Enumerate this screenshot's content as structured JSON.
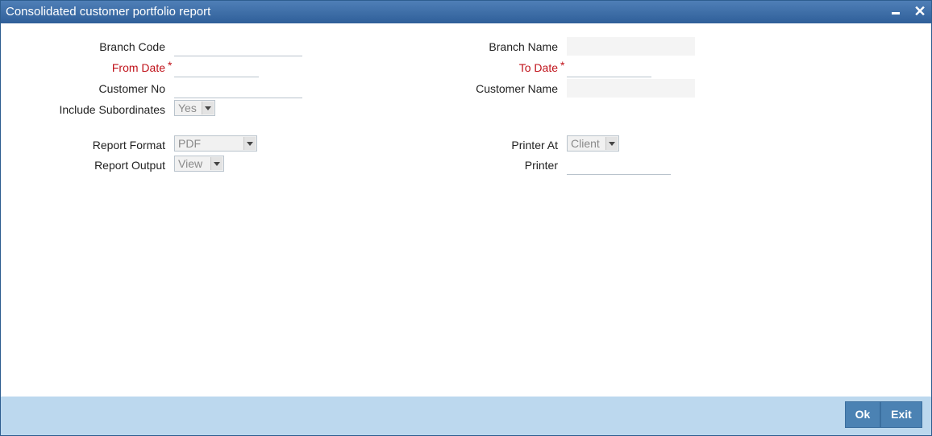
{
  "window": {
    "title": "Consolidated customer portfolio report"
  },
  "form": {
    "branch_code_label": "Branch Code",
    "branch_name_label": "Branch Name",
    "from_date_label": "From Date",
    "to_date_label": "To Date",
    "customer_no_label": "Customer No",
    "customer_name_label": "Customer Name",
    "include_subordinates_label": "Include Subordinates",
    "include_subordinates_value": "Yes",
    "report_format_label": "Report Format",
    "report_format_value": "PDF",
    "printer_at_label": "Printer At",
    "printer_at_value": "Client",
    "report_output_label": "Report Output",
    "report_output_value": "View",
    "printer_label": "Printer",
    "required_mark": "*"
  },
  "footer": {
    "ok_label": "Ok",
    "exit_label": "Exit"
  },
  "colors": {
    "titlebar": "#2f5f99",
    "footer": "#bcd8ee",
    "button": "#4b82b3",
    "required": "#c0121a"
  }
}
